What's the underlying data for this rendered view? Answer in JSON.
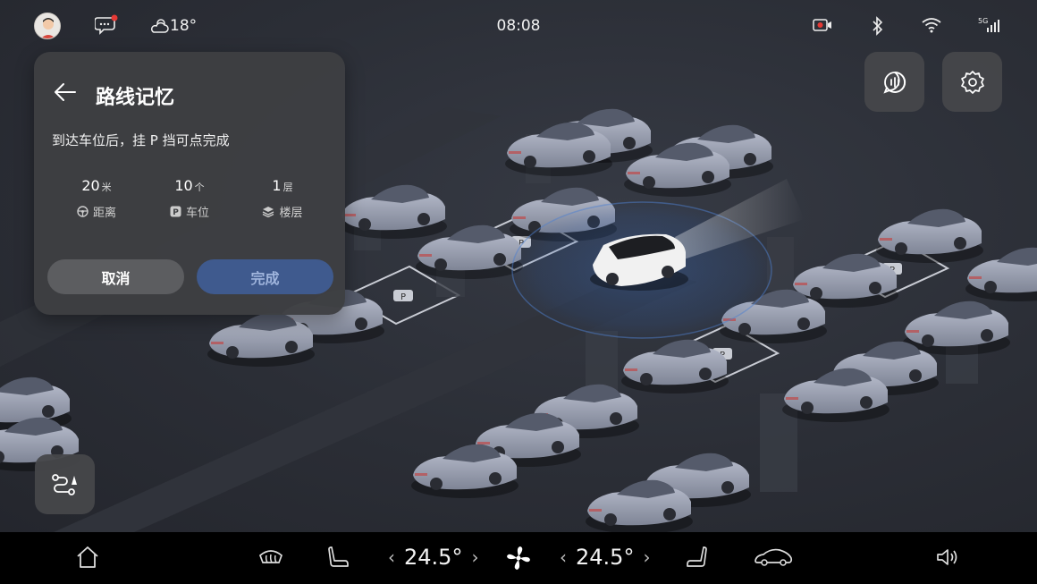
{
  "status_bar": {
    "weather_temp": "18°",
    "time": "08:08",
    "signal_label": "5G"
  },
  "panel": {
    "title": "路线记忆",
    "hint": "到达车位后，挂 P 挡可点完成",
    "stats": [
      {
        "value": "20",
        "unit": "米",
        "label": "距离",
        "icon": "steering-wheel-icon"
      },
      {
        "value": "10",
        "unit": "个",
        "label": "车位",
        "icon": "parking-icon"
      },
      {
        "value": "1",
        "unit": "层",
        "label": "楼层",
        "icon": "layers-icon"
      }
    ],
    "cancel_label": "取消",
    "done_label": "完成"
  },
  "dock": {
    "left_temp": "24.5°",
    "right_temp": "24.5°"
  },
  "colors": {
    "panel_bg": "#3e3f42",
    "done_button": "#3f5a8e",
    "cancel_button": "#5c5d60",
    "scene_bg": "#2b2e36",
    "notification_dot": "#e53935"
  }
}
